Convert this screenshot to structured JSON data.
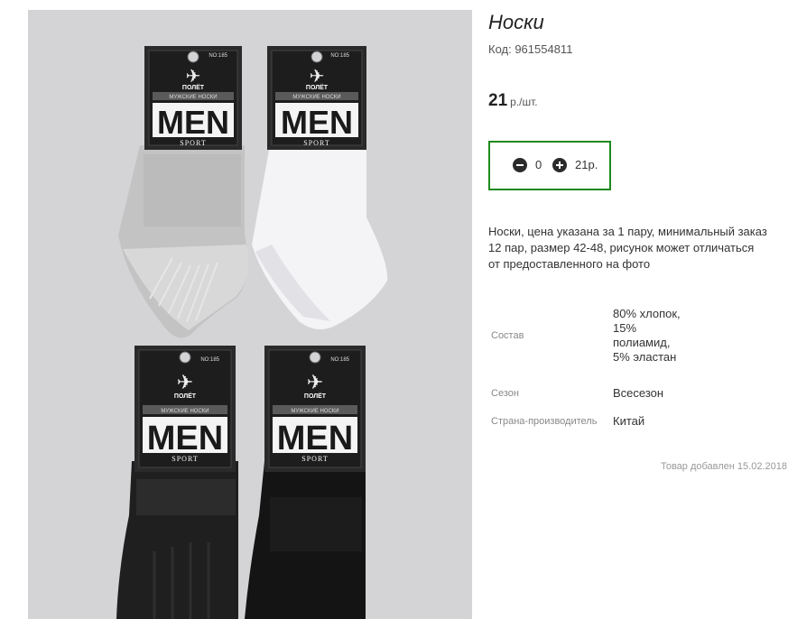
{
  "product": {
    "title": "Носки",
    "code": "Код: 961554811",
    "price": "21",
    "price_unit": "р./шт."
  },
  "quantity": {
    "value": "0",
    "sum": "21р."
  },
  "description": "Носки, цена указана за 1 пару, минимальный заказ 12 пар, размер 42-48, рисунок может отличаться от предоставленного на фото",
  "specs": [
    {
      "label": "Состав",
      "value": "80% хлопок, 15% полиамид, 5% эластан"
    },
    {
      "label": "Сезон",
      "value": "Всесезон"
    },
    {
      "label": "Страна-производитель",
      "value": "Китай"
    }
  ],
  "added_date": "Товар добавлен 15.02.2018",
  "packaging": {
    "brand": "ПОЛЁТ",
    "model": "NO:185",
    "subtitle": "МУЖСКИЕ НОСКИ",
    "big_text": "MEN",
    "line": "SPORT"
  },
  "colors": {
    "accent_border": "#1d8a1d",
    "sock_grey": "#c6c6c6",
    "sock_white": "#f4f4f6",
    "sock_black": "#1c1c1c",
    "photo_bg": "#d4d3d6"
  }
}
